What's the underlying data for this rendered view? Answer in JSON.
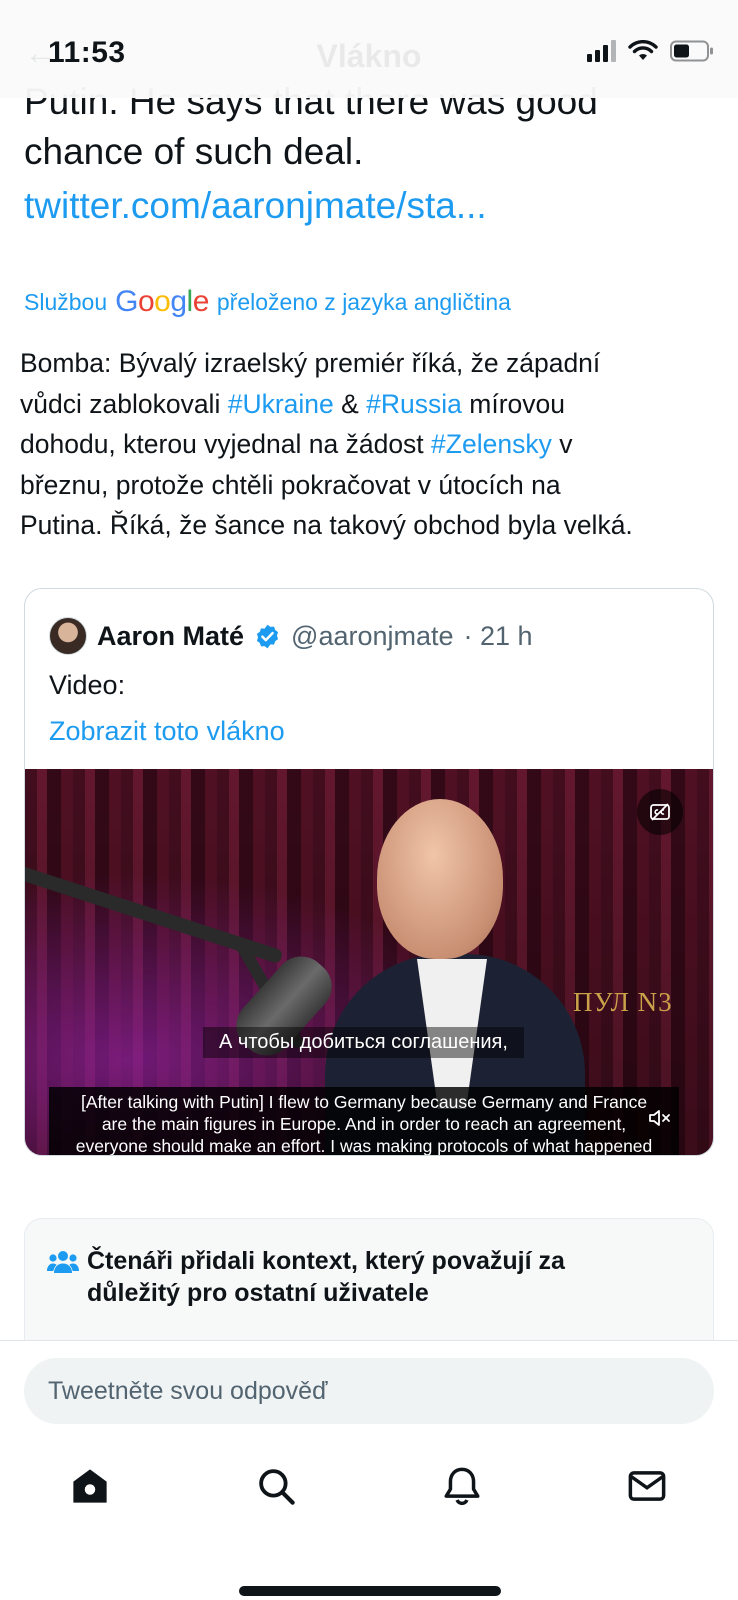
{
  "status_bar": {
    "time": "11:53"
  },
  "header": {
    "title": "Vlákno"
  },
  "tweet": {
    "cut_line": "Putin. He says that there was good",
    "line2": "chance of such deal.",
    "link": "twitter.com/aaronjmate/sta...",
    "translated_prefix": "Službou",
    "translated_suffix": "přeloženo z jazyka angličtina",
    "translation_lines": [
      [
        "Bomba: Bývalý izraelský premiér říká, že západní"
      ],
      [
        "vůdci zablokovali ",
        "#Ukraine",
        " & ",
        "#Russia",
        " mírovou"
      ],
      [
        "dohodu, kterou vyjednal na žádost ",
        "#Zelensky",
        " v"
      ],
      [
        "březnu, protože chtěli pokračovat v útocích na"
      ],
      [
        "Putina. Říká, že šance na takový obchod byla velká."
      ]
    ]
  },
  "quote": {
    "name": "Aaron Maté",
    "handle": "@aaronjmate",
    "time": "· 21 h",
    "text": "Video:",
    "thread_link": "Zobrazit toto vlákno",
    "video": {
      "watermark": "ПУЛ N3",
      "subtitle_ru": "А чтобы добиться соглашения,",
      "subtitle_en": [
        "[After talking with Putin] I flew to Germany because Germany and France",
        "are the main figures in Europe. And in order to reach an agreement,",
        "everyone should make an effort. I was making protocols of what happened"
      ]
    }
  },
  "notes": {
    "title_line1": "Čtenáři přidali kontext, který považují za",
    "title_line2": "důležitý pro ostatní uživatele"
  },
  "reply": {
    "placeholder": "Tweetněte svou odpověď"
  },
  "colors": {
    "accent": "#1d9bf0",
    "text": "#0f1419",
    "muted": "#536471"
  },
  "tabs": [
    {
      "icon": "home-icon"
    },
    {
      "icon": "search-icon"
    },
    {
      "icon": "bell-icon"
    },
    {
      "icon": "mail-icon"
    }
  ]
}
